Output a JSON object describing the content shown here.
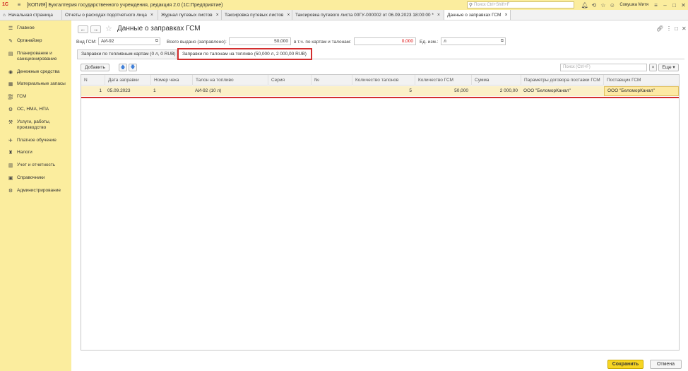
{
  "app": {
    "logo": "1С",
    "title": "[КОПИЯ] Бухгалтерия государственного учреждения, редакция 2.0 (1С:Предприятие)",
    "search_placeholder": "Поиск Ctrl+Shift+F",
    "user": "Совушка Митя"
  },
  "tabs": [
    {
      "label": "Начальная страница"
    },
    {
      "label": "Отчеты о расходах подотчетного лица"
    },
    {
      "label": "Журнал путевых листов"
    },
    {
      "label": "Таксировка путевых листов"
    },
    {
      "label": "Таксировка путевого листа 00ГУ-000002 от 06.09.2023 18:00:00 *"
    },
    {
      "label": "Данные о заправках ГСМ"
    }
  ],
  "sidebar": {
    "items": [
      {
        "label": "Главное",
        "icon": "menu-icon"
      },
      {
        "label": "Органайзер",
        "icon": "organizer-icon"
      },
      {
        "label": "Планирование и санкционирование",
        "icon": "planning-icon"
      },
      {
        "label": "Денежные средства",
        "icon": "money-icon"
      },
      {
        "label": "Материальные запасы",
        "icon": "materials-icon"
      },
      {
        "label": "ГСМ",
        "icon": "fuel-icon"
      },
      {
        "label": "ОС, НМА, НПА",
        "icon": "assets-icon"
      },
      {
        "label": "Услуги, работы, производство",
        "icon": "services-icon"
      },
      {
        "label": "Платное обучение",
        "icon": "education-icon"
      },
      {
        "label": "Налоги",
        "icon": "taxes-icon"
      },
      {
        "label": "Учет и отчетность",
        "icon": "reports-icon"
      },
      {
        "label": "Справочники",
        "icon": "catalogs-icon"
      },
      {
        "label": "Администрирование",
        "icon": "gear-icon"
      }
    ]
  },
  "form": {
    "title": "Данные о заправках ГСМ",
    "fuel_type_label": "Вид ГСМ:",
    "fuel_type_value": "АИ-92",
    "total_issued_label": "Всего выдано (заправлено):",
    "total_issued_value": "50,000",
    "cards_coupons_label": "в т.ч. по картам и талонам:",
    "cards_coupons_value": "0,000",
    "unit_label": "Ед. изм.:",
    "unit_value": "л"
  },
  "subtabs": [
    {
      "label": "Заправки по топливным картам (0 л, 0 RUB)"
    },
    {
      "label": "Заправки по талонам на топливо (50,000 л, 2 000,00  RUB)"
    }
  ],
  "toolbar": {
    "add_label": "Добавить",
    "search_placeholder": "Поиск (Ctrl+F)",
    "more_label": "Еще"
  },
  "table": {
    "headers": [
      "N",
      "Дата заправки",
      "Номер чека",
      "Талон на топливо",
      "Серия",
      "№",
      "Количество талонов",
      "Количество ГСМ",
      "Сумма",
      "Параметры договора поставки ГСМ",
      "Поставщик ГСМ"
    ],
    "rows": [
      [
        "1",
        "05.09.2023",
        "1",
        "АИ-92 (10 л)",
        "",
        "",
        "5",
        "50,000",
        "2 000,00",
        "ООО \"БеломорКанал\"",
        "ООО \"БеломорКанал\""
      ]
    ]
  },
  "footer": {
    "save_label": "Сохранить",
    "cancel_label": "Отмена"
  },
  "colors": {
    "accent_yellow": "#fbed9e",
    "highlight_red": "#d32f2f",
    "save_button": "#f7d523"
  }
}
